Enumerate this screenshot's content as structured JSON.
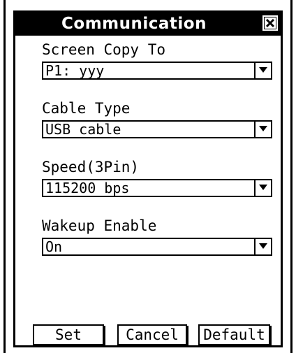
{
  "dialog": {
    "title": "Communication",
    "close_icon": "close-x-icon"
  },
  "fields": [
    {
      "label": "Screen Copy To",
      "value": "P1: yyy"
    },
    {
      "label": "Cable Type",
      "value": "USB cable"
    },
    {
      "label": "Speed(3Pin)",
      "value": "115200 bps"
    },
    {
      "label": "Wakeup Enable",
      "value": "On"
    }
  ],
  "buttons": {
    "set": "Set",
    "cancel": "Cancel",
    "default": "Default"
  }
}
